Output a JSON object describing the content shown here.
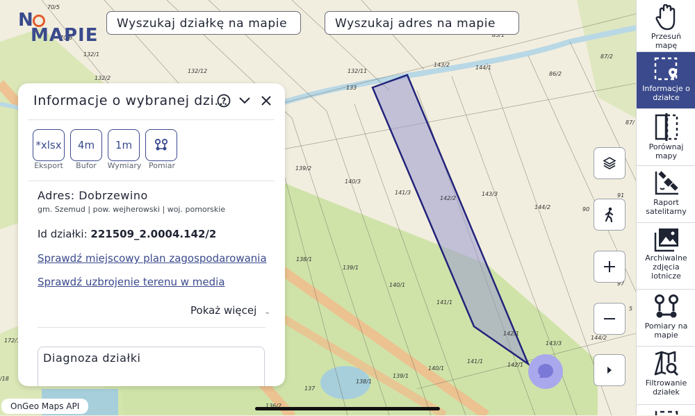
{
  "logo": {
    "text_top": "N",
    "text_bottom": "MAPIE"
  },
  "search": {
    "parcel_placeholder": "Wyszukaj działkę na mapie",
    "address_placeholder": "Wyszukaj adres na mapie"
  },
  "panel": {
    "title": "Informacje o wybranej dzi...",
    "tools": [
      {
        "icon_text": "*xlsx",
        "label": "Eksport"
      },
      {
        "icon_text": "4m",
        "label": "Bufor"
      },
      {
        "icon_text": "1m",
        "label": "Wymiary"
      },
      {
        "icon_text": "",
        "label": "Pomiar"
      }
    ],
    "address_title": "Adres: Dobrzewino",
    "address_sub": "gm. Szemud | pow. wejherowski | woj. pomorskie",
    "id_label": "Id działki:",
    "id_value": "221509_2.0004.142/2",
    "link_plan": "Sprawdź miejscowy plan zagospodarowania",
    "link_media": "Sprawdź uzbrojenie terenu w media",
    "show_more": "Pokaż więcej",
    "diagnosis_title": "Diagnoza działki"
  },
  "sidebar": {
    "items": [
      {
        "label": "Przesuń mapę",
        "icon": "hand-icon",
        "active": false
      },
      {
        "label": "Informacje o działce",
        "icon": "parcel-info-icon",
        "active": true
      },
      {
        "label": "Porównaj mapy",
        "icon": "compare-maps-icon",
        "active": false
      },
      {
        "label": "Raport satelitarny",
        "icon": "satellite-icon",
        "active": false
      },
      {
        "label": "Archiwalne zdjęcia lotnicze",
        "icon": "image-icon",
        "active": false
      },
      {
        "label": "Pomiary na mapie",
        "icon": "measure-icon",
        "active": false
      },
      {
        "label": "Filtrowanie działek",
        "icon": "filter-map-icon",
        "active": false
      }
    ]
  },
  "map_labels": [
    "70/5",
    "70/6",
    "132/1",
    "132/2",
    "132/12",
    "132/11",
    "133",
    "143/2",
    "144/1",
    "85/1",
    "87/2",
    "86/2",
    "139/2",
    "140/3",
    "141/3",
    "142/2",
    "143/3",
    "144/2",
    "91",
    "90",
    "87/",
    "138/1",
    "139/1",
    "140/1",
    "141/1",
    "142/1",
    "143/3",
    "172/1",
    "/18",
    "137",
    "136/2",
    "138/1",
    "139/1",
    "140/1",
    "141/1",
    "142/1",
    "144/2",
    "97",
    "5"
  ],
  "footer": {
    "ongeo": "OnGeo Maps API"
  },
  "colors": {
    "accent": "#3a4a8c",
    "parcel_fill": "#9a9ad0",
    "chat": "#a9a8ec"
  }
}
